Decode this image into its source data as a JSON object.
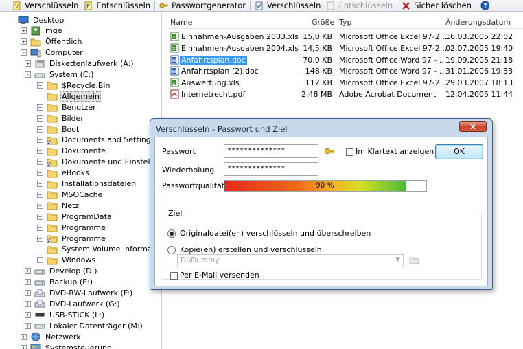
{
  "toolbar": {
    "items": [
      {
        "label": "Verschlüsseln",
        "icon": "encrypt-icon",
        "disabled": false
      },
      {
        "label": "Entschlüsseln",
        "icon": "decrypt-icon",
        "disabled": false
      },
      {
        "label": "Passwortgenerator",
        "icon": "key-icon",
        "disabled": false
      },
      {
        "label": "Verschlüsseln",
        "icon": "encrypt-doc-icon",
        "disabled": false
      },
      {
        "label": "Entschlüsseln",
        "icon": "decrypt-doc-icon",
        "disabled": true
      },
      {
        "label": "Sicher löschen",
        "icon": "delete-icon",
        "disabled": false
      }
    ],
    "help_icon": "help-icon"
  },
  "tree": {
    "items": [
      {
        "label": "Desktop",
        "level": 0,
        "expander": "",
        "icon": "desktop-icon"
      },
      {
        "label": "mge",
        "level": 1,
        "expander": "+",
        "icon": "user-folder-icon"
      },
      {
        "label": "Öffentlich",
        "level": 1,
        "expander": "+",
        "icon": "folder-icon"
      },
      {
        "label": "Computer",
        "level": 1,
        "expander": "-",
        "icon": "computer-icon"
      },
      {
        "label": "Diskettenlaufwerk (A:)",
        "level": 2,
        "expander": "+",
        "icon": "floppy-icon"
      },
      {
        "label": "System (C:)",
        "level": 2,
        "expander": "-",
        "icon": "drive-icon"
      },
      {
        "label": "$Recycle.Bin",
        "level": 3,
        "expander": "+",
        "icon": "folder-icon"
      },
      {
        "label": "Allgemein",
        "level": 3,
        "expander": "",
        "icon": "folder-icon",
        "selected": true
      },
      {
        "label": "Benutzer",
        "level": 3,
        "expander": "+",
        "icon": "folder-icon"
      },
      {
        "label": "Bilder",
        "level": 3,
        "expander": "+",
        "icon": "folder-icon"
      },
      {
        "label": "Boot",
        "level": 3,
        "expander": "+",
        "icon": "folder-icon"
      },
      {
        "label": "Documents and Settings",
        "level": 3,
        "expander": "+",
        "icon": "shortcut-folder-icon"
      },
      {
        "label": "Dokumente",
        "level": 3,
        "expander": "+",
        "icon": "folder-icon"
      },
      {
        "label": "Dokumente und Einstellung",
        "level": 3,
        "expander": "+",
        "icon": "shortcut-folder-icon"
      },
      {
        "label": "eBooks",
        "level": 3,
        "expander": "+",
        "icon": "folder-icon"
      },
      {
        "label": "Installationsdateien",
        "level": 3,
        "expander": "+",
        "icon": "folder-icon"
      },
      {
        "label": "MSOCache",
        "level": 3,
        "expander": "+",
        "icon": "folder-icon"
      },
      {
        "label": "Netz",
        "level": 3,
        "expander": "+",
        "icon": "folder-icon"
      },
      {
        "label": "ProgramData",
        "level": 3,
        "expander": "+",
        "icon": "folder-icon"
      },
      {
        "label": "Programme",
        "level": 3,
        "expander": "+",
        "icon": "folder-icon"
      },
      {
        "label": "Programme",
        "level": 3,
        "expander": "+",
        "icon": "shortcut-folder-icon"
      },
      {
        "label": "System Volume Information",
        "level": 3,
        "expander": "",
        "icon": "folder-icon"
      },
      {
        "label": "Windows",
        "level": 3,
        "expander": "+",
        "icon": "folder-icon"
      },
      {
        "label": "Develop (D:)",
        "level": 2,
        "expander": "+",
        "icon": "drive-icon"
      },
      {
        "label": "Backup (E:)",
        "level": 2,
        "expander": "+",
        "icon": "drive-icon"
      },
      {
        "label": "DVD-RW-Laufwerk (F:)",
        "level": 2,
        "expander": "+",
        "icon": "dvd-icon"
      },
      {
        "label": "DVD-Laufwerk (G:)",
        "level": 2,
        "expander": "+",
        "icon": "dvd-icon"
      },
      {
        "label": "USB-STICK (L:)",
        "level": 2,
        "expander": "+",
        "icon": "usb-icon"
      },
      {
        "label": "Lokaler Datenträger (M:)",
        "level": 2,
        "expander": "+",
        "icon": "drive-icon"
      },
      {
        "label": "Netzwerk",
        "level": 1,
        "expander": "+",
        "icon": "network-icon"
      },
      {
        "label": "Systemsteuerung",
        "level": 1,
        "expander": "+",
        "icon": "control-panel-icon"
      }
    ]
  },
  "list": {
    "columns": {
      "name": "Name",
      "size": "Größe",
      "type": "Typ",
      "date": "Änderungsdatum"
    },
    "rows": [
      {
        "name": "Einnahmen-Ausgaben 2003.xls",
        "size": "15,0 KB",
        "type": "Microsoft Office Excel 97-2...",
        "date": "16.03.2005 22:02",
        "icon": "excel-file-icon"
      },
      {
        "name": "Einnahmen-Ausgaben 2004.xls",
        "size": "14,5 KB",
        "type": "Microsoft Office Excel 97-2...",
        "date": "02.07.2005 19:40",
        "icon": "excel-file-icon"
      },
      {
        "name": "Anfahrtsplan.doc",
        "size": "70,0 KB",
        "type": "Microsoft Office Word 97 - ...",
        "date": "19.09.2005 21:18",
        "icon": "word-file-icon",
        "selected": true
      },
      {
        "name": "Anfahrtsplan (2).doc",
        "size": "148 KB",
        "type": "Microsoft Office Word 97 - ...",
        "date": "31.01.2006 19:33",
        "icon": "word-file-icon"
      },
      {
        "name": "Auswertung.xls",
        "size": "112 KB",
        "type": "Microsoft Office Excel 97-2...",
        "date": "29.03.2007 18:13",
        "icon": "excel-file-icon"
      },
      {
        "name": "Internetrecht.pdf",
        "size": "2,48 MB",
        "type": "Adobe Acrobat Document",
        "date": "12.04.2005 11:44",
        "icon": "pdf-file-icon"
      }
    ]
  },
  "dialog": {
    "title": "Verschlüsseln - Passwort und Ziel",
    "close_label": "x",
    "password_label": "Passwort",
    "password_value": "**************",
    "repeat_label": "Wiederholung",
    "repeat_value": "**************",
    "cleartext_label": "Im Klartext anzeigen",
    "ok_label": "OK",
    "quality_label": "Passwortqualität",
    "quality_percent": 90,
    "quality_text": "90 %",
    "group_label": "Ziel",
    "option1_label": "Originaldatei(en) verschlüsseln und überschreiben",
    "option2_label": "Kopie(en) erstellen und verschlüsseln",
    "target_path": "D:\\Dummy",
    "email_label": "Per E-Mail versenden"
  },
  "colors": {
    "selection": "#3399ff",
    "dialog_frame": "#c9d9ec",
    "close_button": "#c8442c"
  }
}
